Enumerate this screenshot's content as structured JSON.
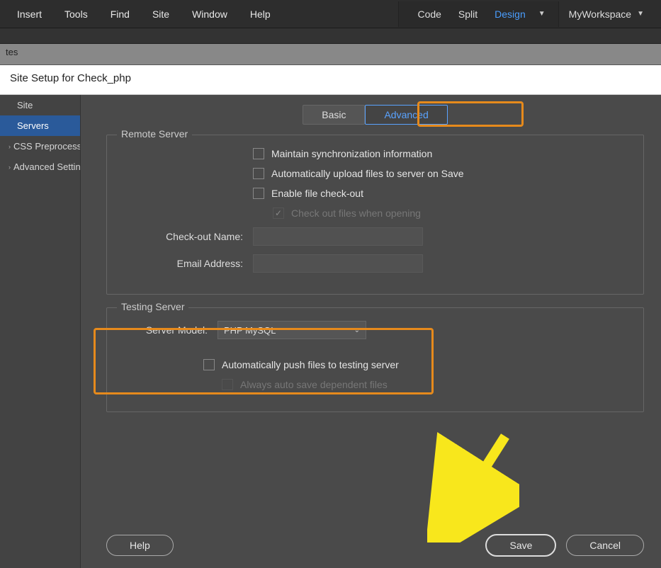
{
  "menubar": {
    "items": [
      "Insert",
      "Tools",
      "Find",
      "Site",
      "Window",
      "Help"
    ],
    "views": {
      "code": "Code",
      "split": "Split",
      "design": "Design"
    },
    "workspace": "MyWorkspace"
  },
  "tabstrip": {
    "label": "tes"
  },
  "dialog": {
    "title": "Site Setup for Check_php",
    "sidebar": {
      "items": [
        {
          "label": "Site",
          "expandable": false
        },
        {
          "label": "Servers",
          "expandable": false,
          "active": true
        },
        {
          "label": "CSS Preprocessors",
          "expandable": true
        },
        {
          "label": "Advanced Settings",
          "expandable": true
        }
      ]
    },
    "tabs": {
      "basic": "Basic",
      "advanced": "Advanced"
    },
    "remote": {
      "legend": "Remote Server",
      "maintain_sync": "Maintain synchronization information",
      "auto_upload": "Automatically upload files to server on Save",
      "enable_checkout": "Enable file check-out",
      "checkout_on_open": "Check out files when opening",
      "checkout_name_label": "Check-out Name:",
      "email_label": "Email Address:",
      "checkout_name_value": "",
      "email_value": ""
    },
    "testing": {
      "legend": "Testing Server",
      "server_model_label": "Server Model:",
      "server_model_value": "PHP MySQL",
      "auto_push": "Automatically push files to testing server",
      "always_autosave": "Always auto save dependent files"
    },
    "buttons": {
      "help": "Help",
      "save": "Save",
      "cancel": "Cancel"
    }
  }
}
